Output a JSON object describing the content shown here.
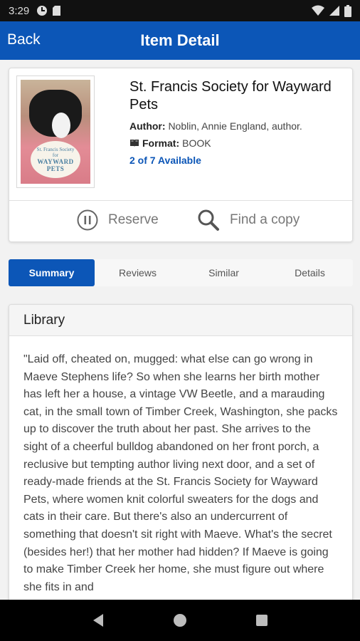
{
  "status_bar": {
    "time": "3:29"
  },
  "app_bar": {
    "back_label": "Back",
    "title": "Item Detail"
  },
  "item": {
    "title": "St. Francis Society for Wayward Pets",
    "author_label": "Author:",
    "author_value": "Noblin, Annie England, author.",
    "format_label": "Format:",
    "format_value": "BOOK",
    "availability": "2 of 7 Available",
    "cover_text": {
      "line1": "St. Francis Society",
      "line2": "for",
      "line3": "WAYWARD",
      "line4": "PETS"
    }
  },
  "actions": {
    "reserve_label": "Reserve",
    "find_label": "Find a copy"
  },
  "tabs": [
    {
      "label": "Summary",
      "active": true
    },
    {
      "label": "Reviews",
      "active": false
    },
    {
      "label": "Similar",
      "active": false
    },
    {
      "label": "Details",
      "active": false
    }
  ],
  "summary": {
    "header": "Library",
    "text": "\"Laid off, cheated on, mugged: what else can go wrong in Maeve Stephens life? So when she learns her birth mother has left her a house, a vintage VW Beetle, and a marauding cat, in the small town of Timber Creek, Washington, she packs up to discover the truth about her past. She arrives to the sight of a cheerful bulldog abandoned on her front porch, a reclusive but tempting author living next door, and a set of ready-made friends at the St. Francis Society for Wayward Pets, where women knit colorful sweaters for the dogs and cats in their care. But there's also an undercurrent of something that doesn't sit right with Maeve. What's the secret (besides her!) that her mother had hidden? If Maeve is going to make Timber Creek her home, she must figure out where she fits in and"
  },
  "colors": {
    "brand_blue": "#0c56b7",
    "status_bar": "#111111",
    "nav_bar": "#000000"
  }
}
